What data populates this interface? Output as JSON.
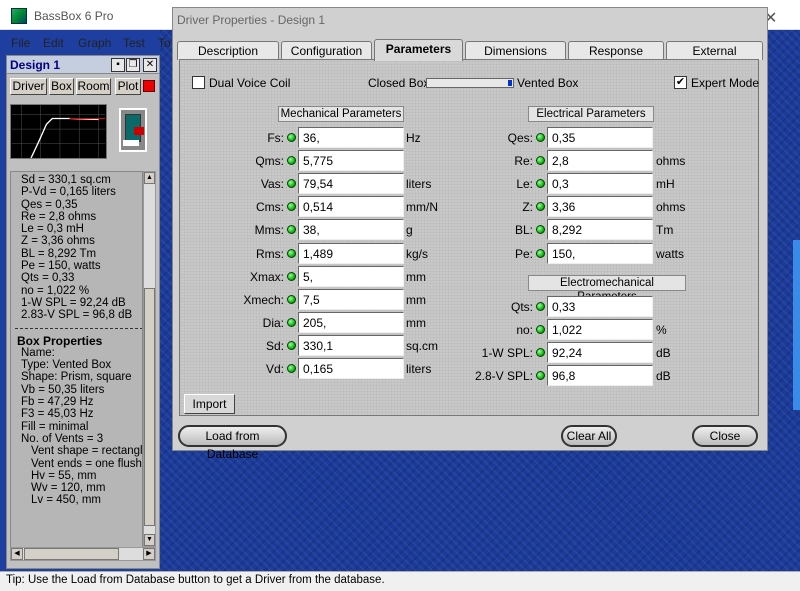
{
  "app": {
    "title": "BassBox 6 Pro",
    "close_glyph": "✕"
  },
  "menu": [
    "File",
    "Edit",
    "Graph",
    "Test",
    "To"
  ],
  "design_panel": {
    "title": "Design 1",
    "buttons": [
      "Driver",
      "Box",
      "Room",
      "Plot"
    ],
    "driver_info": [
      "Sd = 330,1 sq.cm",
      "P-Vd = 0,165 liters",
      "Qes = 0,35",
      "Re = 2,8 ohms",
      "Le = 0,3 mH",
      "Z = 3,36 ohms",
      "BL = 8,292 Tm",
      "Pe = 150, watts",
      "Qts = 0,33",
      "no = 1,022 %",
      "1-W SPL = 92,24 dB",
      "2.83-V SPL = 96,8 dB"
    ],
    "box_title": "Box Properties",
    "box_info": [
      "Name:",
      "Type: Vented Box",
      "Shape: Prism, square",
      "Vb = 50,35 liters",
      "Fb = 47,29 Hz",
      "F3 = 45,03 Hz",
      "Fill = minimal",
      "No. of Vents = 3"
    ],
    "vent_info": [
      "Vent shape = rectangle",
      "Vent ends = one flush",
      "Hv = 55, mm",
      "Wv = 120, mm",
      "Lv = 450, mm"
    ]
  },
  "dialog": {
    "title": "Driver Properties - Design 1",
    "tabs": [
      "Description",
      "Configuration",
      "Parameters",
      "Dimensions",
      "Response",
      "External"
    ],
    "active_tab": "Parameters",
    "dual_voice_coil": {
      "label": "Dual Voice Coil",
      "checked": false
    },
    "closed_box_label": "Closed Box",
    "vented_box_label": "Vented Box",
    "expert_mode": {
      "label": "Expert Mode",
      "checked": true
    },
    "mechanical": {
      "title": "Mechanical Parameters",
      "rows": [
        {
          "label": "Fs:",
          "value": "36,",
          "unit": "Hz"
        },
        {
          "label": "Qms:",
          "value": "5,775",
          "unit": ""
        },
        {
          "label": "Vas:",
          "value": "79,54",
          "unit": "liters"
        },
        {
          "label": "Cms:",
          "value": "0,514",
          "unit": "mm/N"
        },
        {
          "label": "Mms:",
          "value": "38,",
          "unit": "g"
        },
        {
          "label": "Rms:",
          "value": "1,489",
          "unit": "kg/s"
        },
        {
          "label": "Xmax:",
          "value": "5,",
          "unit": "mm"
        },
        {
          "label": "Xmech:",
          "value": "7,5",
          "unit": "mm"
        },
        {
          "label": "Dia:",
          "value": "205,",
          "unit": "mm"
        },
        {
          "label": "Sd:",
          "value": "330,1",
          "unit": "sq.cm"
        },
        {
          "label": "Vd:",
          "value": "0,165",
          "unit": "liters"
        }
      ]
    },
    "electrical": {
      "title": "Electrical Parameters",
      "rows": [
        {
          "label": "Qes:",
          "value": "0,35",
          "unit": ""
        },
        {
          "label": "Re:",
          "value": "2,8",
          "unit": "ohms"
        },
        {
          "label": "Le:",
          "value": "0,3",
          "unit": "mH"
        },
        {
          "label": "Z:",
          "value": "3,36",
          "unit": "ohms"
        },
        {
          "label": "BL:",
          "value": "8,292",
          "unit": "Tm"
        },
        {
          "label": "Pe:",
          "value": "150,",
          "unit": "watts"
        }
      ]
    },
    "electromechanical": {
      "title": "Electromechanical Parameters",
      "rows": [
        {
          "label": "Qts:",
          "value": "0,33",
          "unit": ""
        },
        {
          "label": "no:",
          "value": "1,022",
          "unit": "%"
        },
        {
          "label": "1-W SPL:",
          "value": "92,24",
          "unit": "dB"
        },
        {
          "label": "2.8-V SPL:",
          "value": "96,8",
          "unit": "dB"
        }
      ]
    },
    "import_button": "Import",
    "load_button": "Load from Database",
    "clear_button": "Clear All",
    "close_button": "Close"
  },
  "status_tip": "Tip: Use the Load from Database button to get a Driver from the database."
}
